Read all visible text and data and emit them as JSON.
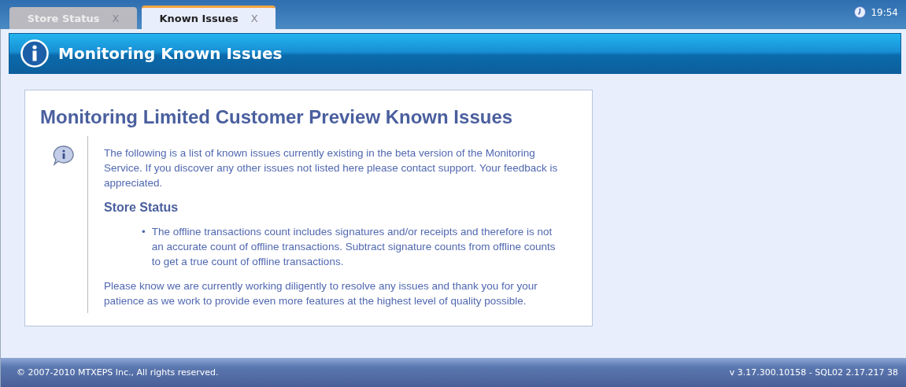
{
  "tabs": [
    {
      "label": "Store Status",
      "close": "X",
      "selected": false
    },
    {
      "label": "Known Issues",
      "close": "X",
      "selected": true
    }
  ],
  "clock": "19:54",
  "header": {
    "title": "Monitoring Known Issues"
  },
  "notice": {
    "title": "Monitoring Limited Customer Preview Known Issues",
    "intro": "The following is a list of known issues currently existing in the beta version of the Monitoring Service. If you discover any other issues not listed here please contact support. Your feedback is appreciated.",
    "sections": [
      {
        "heading": "Store Status",
        "items": [
          {
            "bullet": "•",
            "text": "The offline transactions count includes signatures and/or receipts and therefore is not an accurate count of offline transactions. Subtract signature counts from offline counts to get a true count of offline transactions."
          }
        ]
      }
    ],
    "closing": "Please know we are currently working diligently to resolve any issues and thank you for your patience as we work to provide even more features at the highest level of quality possible."
  },
  "status_bar": {
    "copyright": "© 2007-2010 MTXEPS Inc., All rights reserved.",
    "version": "v 3.17.300.10158 - SQL02 2.17.217 38"
  }
}
